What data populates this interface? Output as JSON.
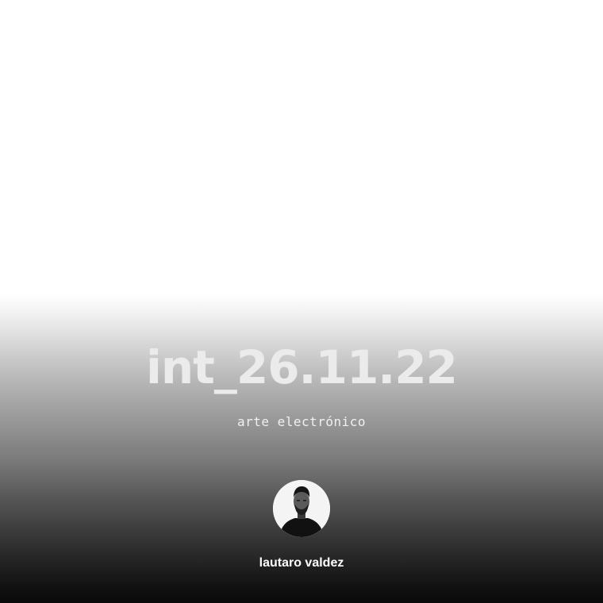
{
  "title": "int_26.11.22",
  "subtitle": "arte electrónico",
  "author": {
    "name": "lautaro valdez"
  },
  "colors": {
    "title": "#ebebeb",
    "text": "#ffffff",
    "avatar_bg": "#f4f4f4"
  }
}
